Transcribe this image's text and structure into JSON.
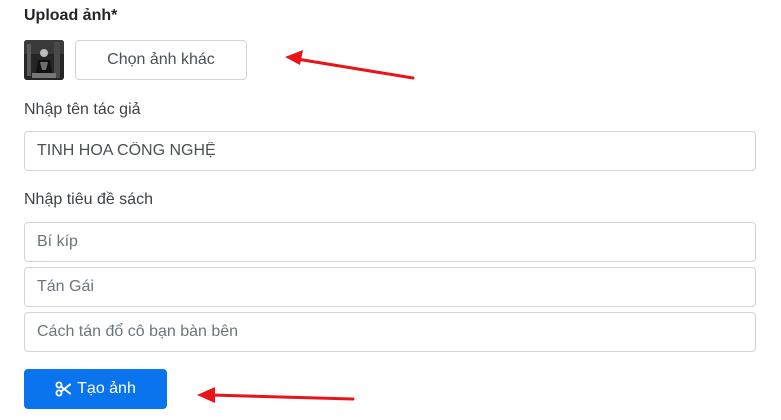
{
  "upload": {
    "label": "Upload ảnh*",
    "change_button_label": "Chọn ảnh khác"
  },
  "author": {
    "label": "Nhập tên tác giả",
    "value": "TINH HOA CÔNG NGHỆ"
  },
  "title": {
    "label": "Nhập tiêu đề sách",
    "lines": [
      {
        "placeholder": "Bí kíp"
      },
      {
        "placeholder": "Tán Gái"
      },
      {
        "placeholder": "Cách tán đổ cô bạn bàn bên"
      }
    ]
  },
  "submit": {
    "icon": "scissors-icon",
    "label": "Tạo ảnh"
  },
  "colors": {
    "primary": "#0a74ee",
    "annotation_arrow": "#e8141a",
    "border": "#ced4da"
  }
}
